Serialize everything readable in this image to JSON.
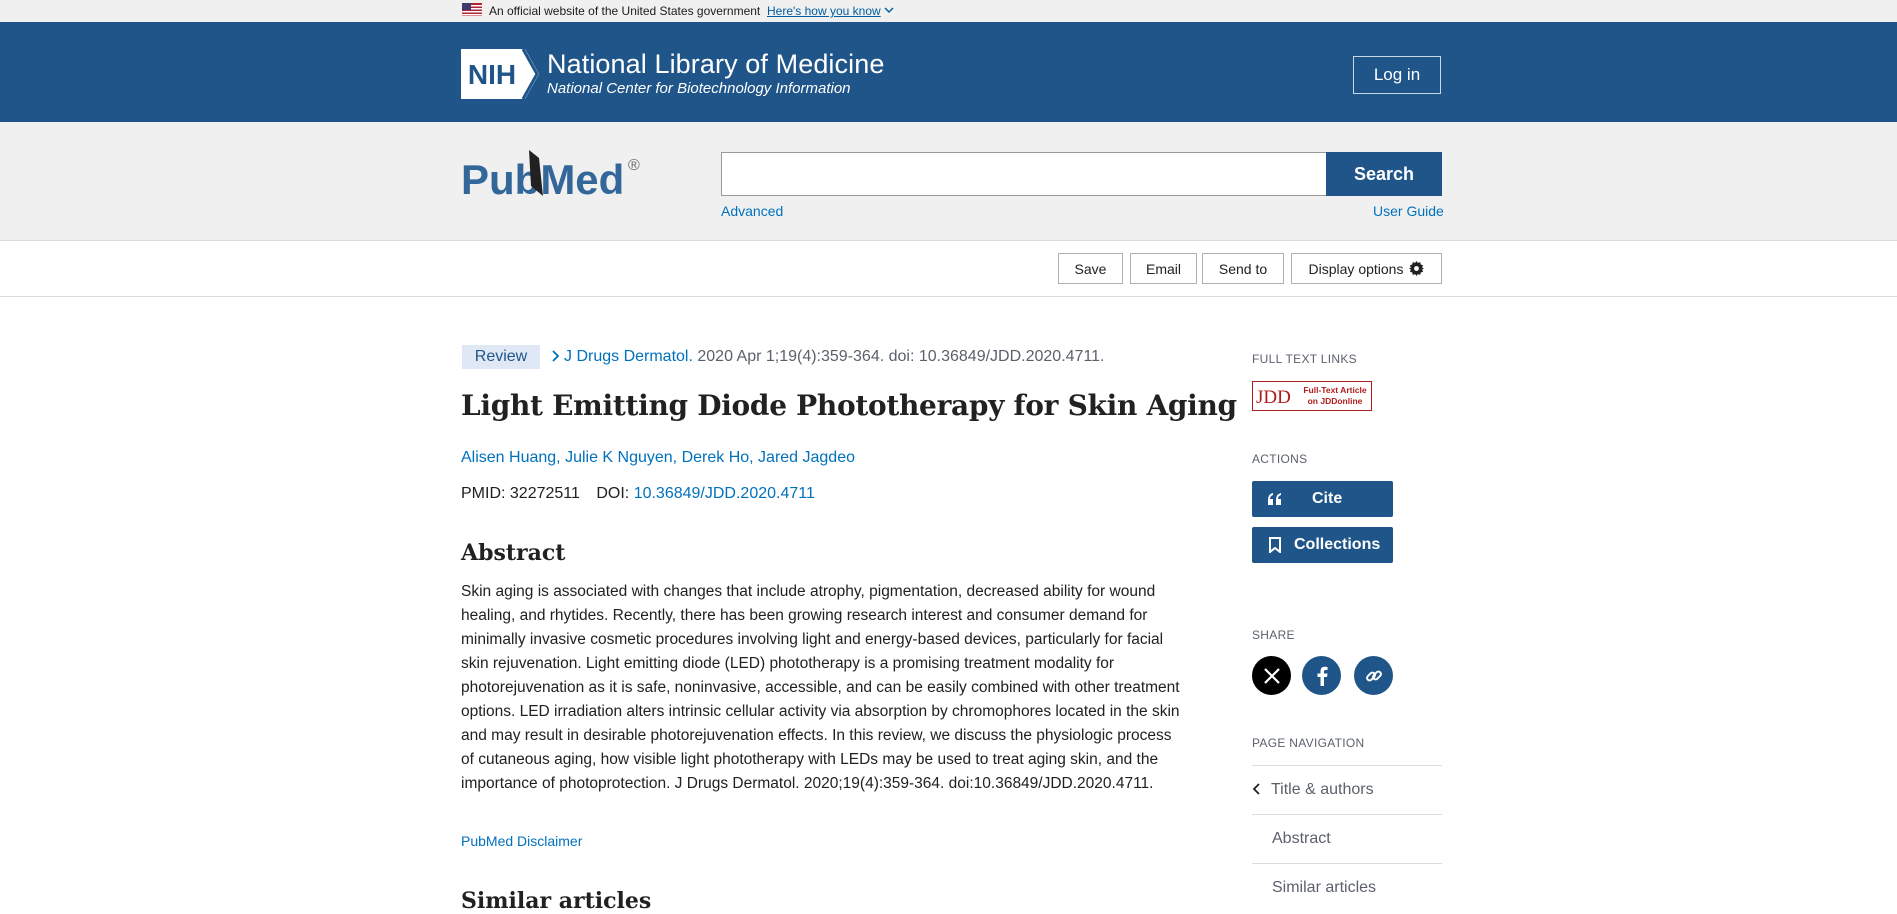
{
  "gov_banner": {
    "text": "An official website of the United States government",
    "link": "Here's how you know"
  },
  "nih_header": {
    "logo_text": "NIH",
    "title": "National Library of Medicine",
    "subtitle": "National Center for Biotechnology Information",
    "login_label": "Log in"
  },
  "search": {
    "logo_text": "PubMed",
    "query": "",
    "button_label": "Search",
    "advanced_label": "Advanced",
    "user_guide_label": "User Guide"
  },
  "toolbar": {
    "save_label": "Save",
    "email_label": "Email",
    "send_to_label": "Send to",
    "display_options_label": "Display options"
  },
  "article": {
    "type_badge": "Review",
    "journal": "J Drugs Dermatol.",
    "citation": " 2020 Apr 1;19(4):359-364. doi: 10.36849/JDD.2020.4711.",
    "title": "Light Emitting Diode Phototherapy for Skin Aging",
    "authors": "Alisen Huang, Julie K Nguyen, Derek Ho, Jared Jagdeo",
    "pmid_label": "PMID: 32272511",
    "doi_label": "DOI: ",
    "doi_value": "10.36849/JDD.2020.4711",
    "abstract_heading": "Abstract",
    "abstract_text": "Skin aging is associated with changes that include atrophy, pigmentation, decreased ability for wound healing, and rhytides. Recently, there has been growing research interest and consumer demand for minimally invasive cosmetic procedures involving light and energy-based devices, particularly for facial skin rejuvenation. Light emitting diode (LED) phototherapy is a promising treatment modality for photorejuvenation as it is safe, noninvasive, accessible, and can be easily combined with other treatment options. LED irradiation alters intrinsic cellular activity via absorption by chromophores located in the skin and may result in desirable photorejuvenation effects. In this review, we discuss the physiologic process of cutaneous aging, how visible light phototherapy with LEDs may be used to treat aging skin, and the importance of photoprotection. J Drugs Dermatol. 2020;19(4):359-364. doi:10.36849/JDD.2020.4711.",
    "disclaimer_label": "PubMed Disclaimer",
    "similar_heading": "Similar articles"
  },
  "sidebar": {
    "full_text_heading": "FULL TEXT LINKS",
    "jdd_logo_text": "JDD",
    "jdd_logo_caption_1": "Full-Text Article",
    "jdd_logo_caption_2": "on JDDonline",
    "actions_heading": "ACTIONS",
    "cite_label": "Cite",
    "collections_label": "Collections",
    "share_heading": "SHARE",
    "page_nav_heading": "PAGE NAVIGATION",
    "nav_items": [
      "Title & authors",
      "Abstract",
      "Similar articles"
    ]
  },
  "colors": {
    "nih_blue": "#20558a",
    "link_blue": "#0071bc",
    "badge_bg": "#dfe8f4",
    "jdd_red": "#b01c1c"
  }
}
